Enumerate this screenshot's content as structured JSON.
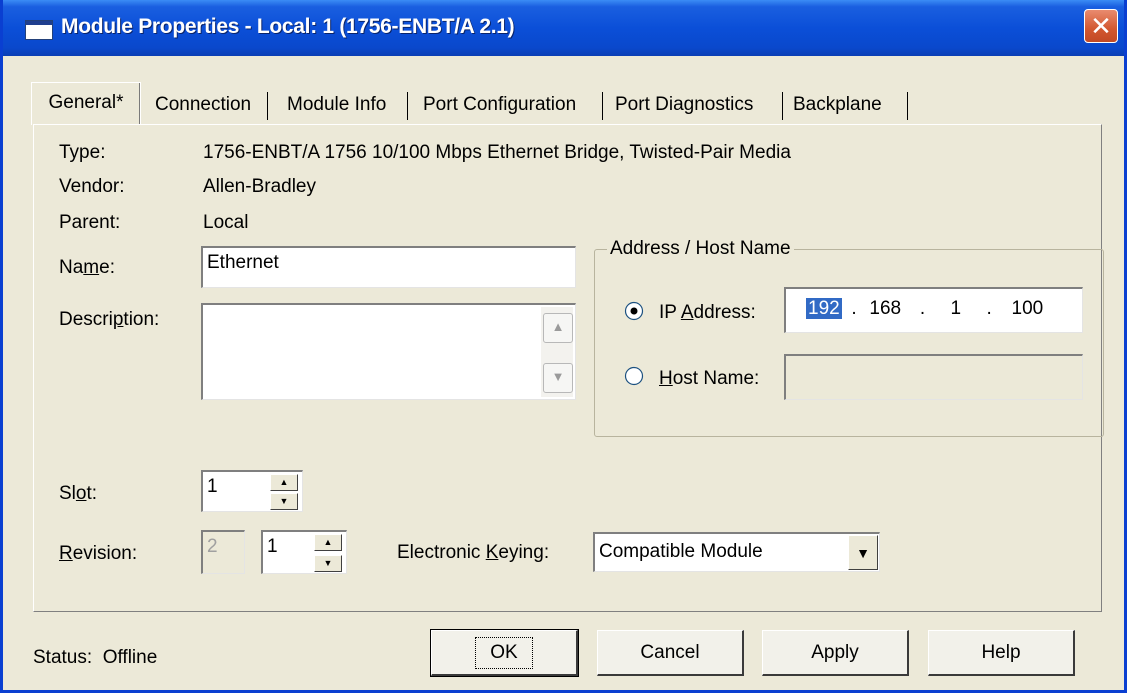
{
  "window": {
    "title": "Module Properties - Local: 1 (1756-ENBT/A 2.1)",
    "close_glyph": "✕"
  },
  "tabs": [
    {
      "label": "General*",
      "active": true
    },
    {
      "label": "Connection",
      "active": false
    },
    {
      "label": "Module Info",
      "active": false
    },
    {
      "label": "Port Configuration",
      "active": false
    },
    {
      "label": "Port Diagnostics",
      "active": false
    },
    {
      "label": "Backplane",
      "active": false
    }
  ],
  "general": {
    "type_label": "Type:",
    "type_value": "1756-ENBT/A 1756 10/100 Mbps Ethernet Bridge, Twisted-Pair Media",
    "vendor_label": "Vendor:",
    "vendor_value": "Allen-Bradley",
    "parent_label": "Parent:",
    "parent_value": "Local",
    "name_label_pre": "Na",
    "name_label_u": "m",
    "name_label_post": "e:",
    "name_value": "Ethernet",
    "desc_label_pre": "Descri",
    "desc_label_u": "p",
    "desc_label_post": "tion:",
    "desc_value": "",
    "slot_label_pre": "Sl",
    "slot_label_u": "o",
    "slot_label_post": "t:",
    "slot_value": "1",
    "rev_label_pre": "",
    "rev_label_u": "R",
    "rev_label_post": "evision:",
    "rev_major": "2",
    "rev_minor": "1",
    "keying_label_pre": "Electronic ",
    "keying_label_u": "K",
    "keying_label_post": "eying:",
    "keying_value": "Compatible Module"
  },
  "address": {
    "group_title": "Address / Host Name",
    "ip_label_pre": "IP ",
    "ip_label_u": "A",
    "ip_label_post": "ddress:",
    "ip_selected": true,
    "ip_octets": [
      "192",
      "168",
      "1",
      "100"
    ],
    "ip_dot": ".",
    "host_label_pre": "",
    "host_label_u": "H",
    "host_label_post": "ost Name:",
    "host_value": ""
  },
  "footer": {
    "status_label": "Status:",
    "status_value": "Offline",
    "ok_label": "OK",
    "cancel_label": "Cancel",
    "apply_label": "Apply",
    "help_label": "Help"
  },
  "colors": {
    "titlebar": "#0b4fd8",
    "dialog_bg": "#ece9d8",
    "selection": "#316ac5",
    "close_button": "#d2572f"
  }
}
